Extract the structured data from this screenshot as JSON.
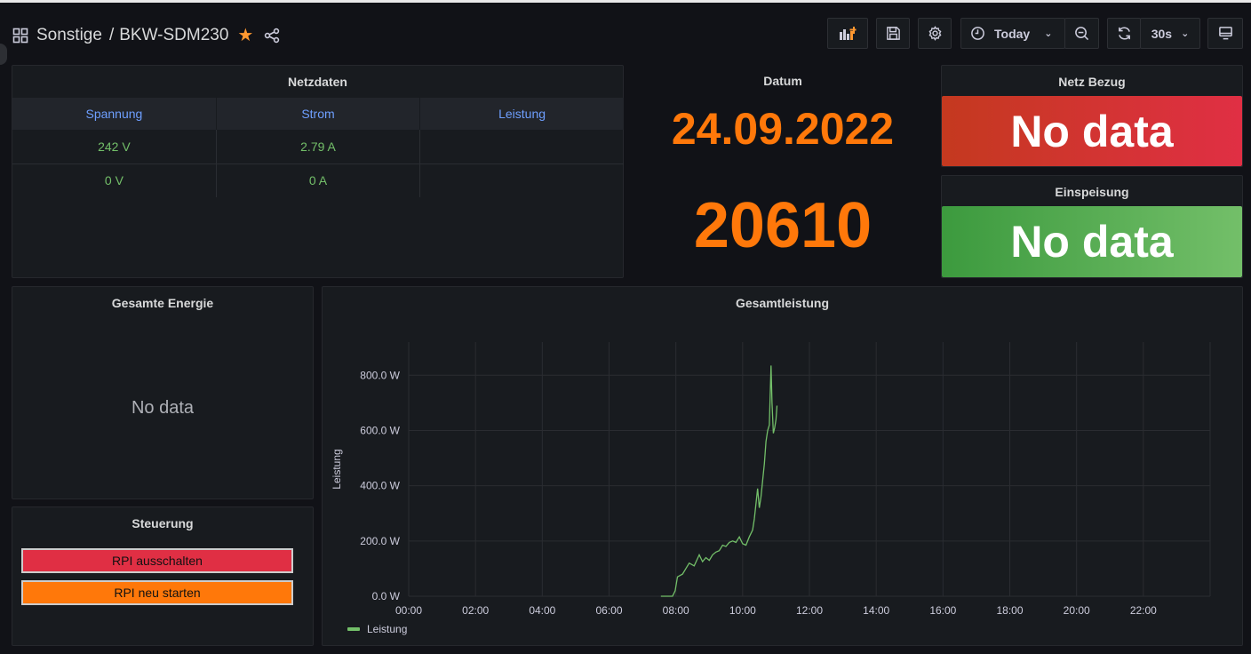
{
  "header": {
    "folder": "Sonstige",
    "dashboard": "BKW-SDM230",
    "time_range": "Today",
    "refresh": "30s"
  },
  "netzdaten": {
    "title": "Netzdaten",
    "columns": [
      "Spannung",
      "Strom",
      "Leistung"
    ],
    "rows": [
      [
        "242 V",
        "2.79 A",
        ""
      ],
      [
        "0 V",
        "0 A",
        ""
      ]
    ]
  },
  "datum": {
    "title": "Datum",
    "date": "24.09.2022",
    "value": "20610"
  },
  "netz_bezug": {
    "title": "Netz Bezug",
    "value": "No data",
    "color": "#e02f44"
  },
  "einspeisung": {
    "title": "Einspeisung",
    "value": "No data",
    "color": "#73bf69"
  },
  "gesamte_energie": {
    "title": "Gesamte Energie",
    "value": "No data"
  },
  "steuerung": {
    "title": "Steuerung",
    "shutdown_label": "RPI ausschalten",
    "restart_label": "RPI neu starten",
    "shutdown_color": "#e02f44",
    "restart_color": "#ff780a"
  },
  "gesamtleistung": {
    "title": "Gesamtleistung"
  },
  "chart_data": {
    "type": "line",
    "title": "Gesamtleistung",
    "xlabel": "",
    "ylabel": "Leistung",
    "x_ticks": [
      "00:00",
      "02:00",
      "04:00",
      "06:00",
      "08:00",
      "10:00",
      "12:00",
      "14:00",
      "16:00",
      "18:00",
      "20:00",
      "22:00"
    ],
    "y_ticks": [
      "0.0 W",
      "200.0 W",
      "400.0 W",
      "600.0 W",
      "800.0 W"
    ],
    "xlim": [
      0,
      24
    ],
    "ylim": [
      0,
      920
    ],
    "grid": true,
    "legend": "bottom-left",
    "series": [
      {
        "name": "Leistung",
        "color": "#73bf69",
        "x": [
          7.55,
          7.9,
          7.98,
          8.05,
          8.2,
          8.3,
          8.4,
          8.55,
          8.7,
          8.8,
          8.9,
          9.0,
          9.1,
          9.2,
          9.3,
          9.4,
          9.5,
          9.6,
          9.7,
          9.8,
          9.9,
          10.0,
          10.1,
          10.2,
          10.3,
          10.35,
          10.45,
          10.5,
          10.55,
          10.6,
          10.65,
          10.7,
          10.75,
          10.8,
          10.85,
          10.88,
          10.92,
          10.96,
          11.0,
          11.03
        ],
        "values": [
          0,
          0,
          20,
          70,
          80,
          100,
          120,
          110,
          150,
          125,
          140,
          130,
          150,
          160,
          165,
          185,
          180,
          195,
          200,
          195,
          215,
          190,
          185,
          215,
          240,
          280,
          390,
          320,
          360,
          420,
          480,
          560,
          600,
          620,
          835,
          700,
          590,
          610,
          640,
          690
        ]
      }
    ]
  }
}
